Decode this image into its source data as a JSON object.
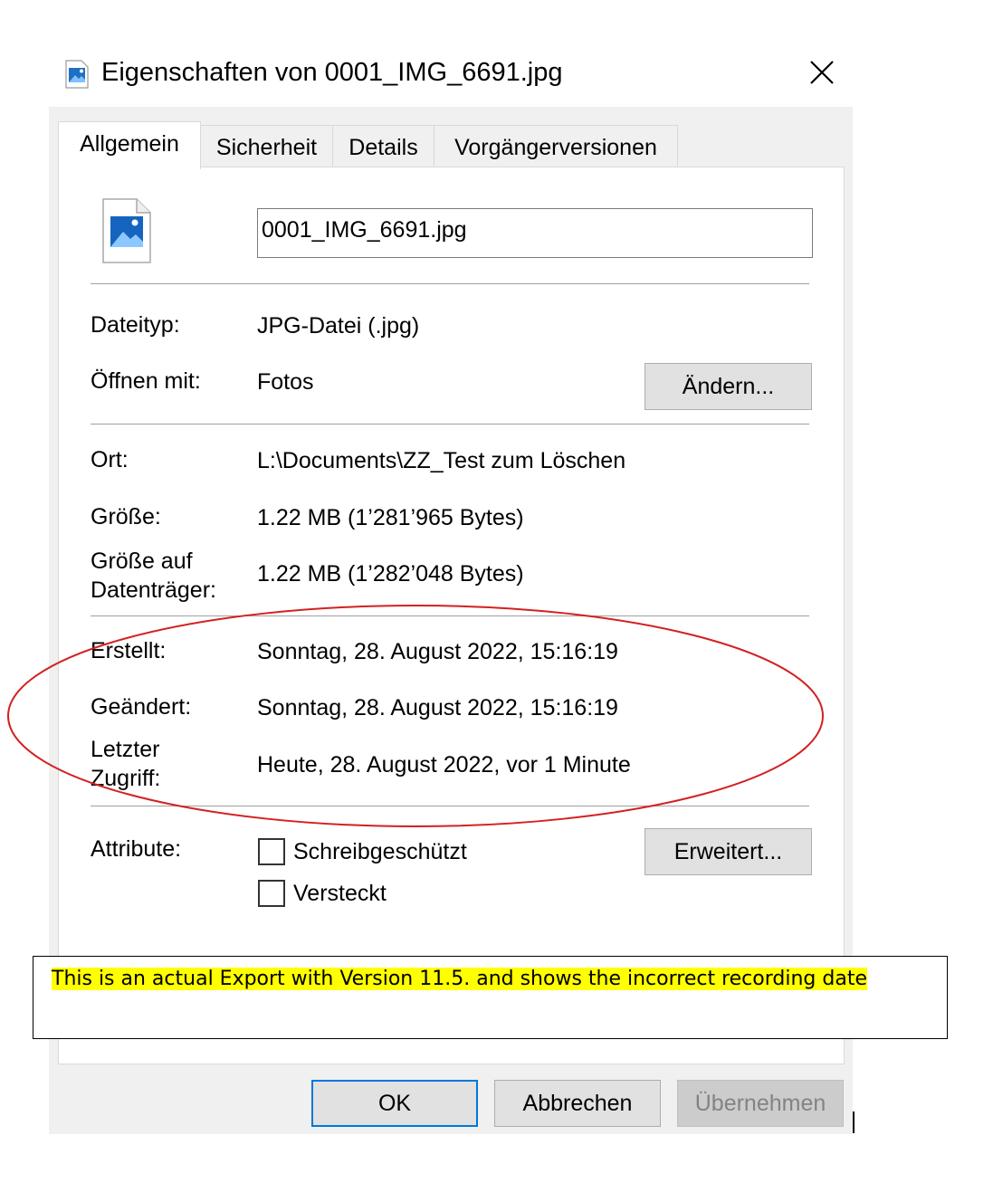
{
  "window": {
    "title": "Eigenschaften von 0001_IMG_6691.jpg",
    "close_symbol": "✕",
    "title_icon": "image-file-icon",
    "close_icon": "close-icon"
  },
  "tabs": [
    {
      "label": "Allgemein",
      "active": true
    },
    {
      "label": "Sicherheit",
      "active": false
    },
    {
      "label": "Details",
      "active": false
    },
    {
      "label": "Vorgängerversionen",
      "active": false
    }
  ],
  "general": {
    "filename": "0001_IMG_6691.jpg",
    "file_icon": "image-file-icon",
    "file_type_label": "Dateityp:",
    "file_type_value": "JPG-Datei (.jpg)",
    "open_with_label": "Öffnen mit:",
    "open_with_value": "Fotos",
    "change_button": "Ändern...",
    "location_label": "Ort:",
    "location_value": "L:\\Documents\\ZZ_Test zum Löschen",
    "size_label": "Größe:",
    "size_value": "1.22 MB (1’281’965 Bytes)",
    "size_on_disk_label_line1": "Größe auf",
    "size_on_disk_label_line2": "Datenträger:",
    "size_on_disk_value": "1.22 MB (1’282’048 Bytes)",
    "created_label": "Erstellt:",
    "created_value": "Sonntag, 28. August 2022, 15:16:19",
    "modified_label": "Geändert:",
    "modified_value": "Sonntag, 28. August 2022, 15:16:19",
    "accessed_label_line1": "Letzter",
    "accessed_label_line2": "Zugriff:",
    "accessed_value": "Heute, 28. August 2022, vor 1 Minute",
    "attributes_label": "Attribute:",
    "readonly_label": "Schreibgeschützt",
    "readonly_checked": false,
    "hidden_label": "Versteckt",
    "hidden_checked": false,
    "advanced_button": "Erweitert..."
  },
  "annotation": {
    "note_text": "This is an actual Export with Version 11.5. and shows the incorrect recording date",
    "highlight_color": "#ffff00",
    "ellipse_color": "#d42020"
  },
  "footer": {
    "ok": "OK",
    "cancel": "Abbrechen",
    "apply": "Übernehmen"
  },
  "colors": {
    "dialog_bg": "#f0f0f0",
    "button_bg": "#e1e1e1",
    "accent": "#0078d7"
  }
}
